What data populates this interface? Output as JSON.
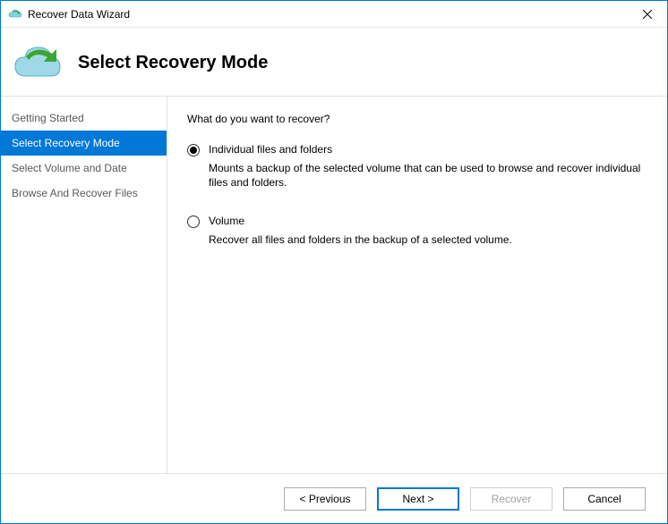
{
  "window": {
    "title": "Recover Data Wizard"
  },
  "header": {
    "heading": "Select Recovery Mode"
  },
  "sidebar": {
    "items": [
      {
        "label": "Getting Started",
        "active": false
      },
      {
        "label": "Select Recovery Mode",
        "active": true
      },
      {
        "label": "Select Volume and Date",
        "active": false
      },
      {
        "label": "Browse And Recover Files",
        "active": false
      }
    ]
  },
  "content": {
    "prompt": "What do you want to recover?",
    "options": [
      {
        "label": "Individual files and folders",
        "description": "Mounts a backup of the selected volume that can be used to browse and recover individual files and folders.",
        "selected": true
      },
      {
        "label": "Volume",
        "description": "Recover all files and folders in the backup of a selected volume.",
        "selected": false
      }
    ]
  },
  "footer": {
    "previous": "< Previous",
    "next": "Next >",
    "recover": "Recover",
    "cancel": "Cancel"
  }
}
